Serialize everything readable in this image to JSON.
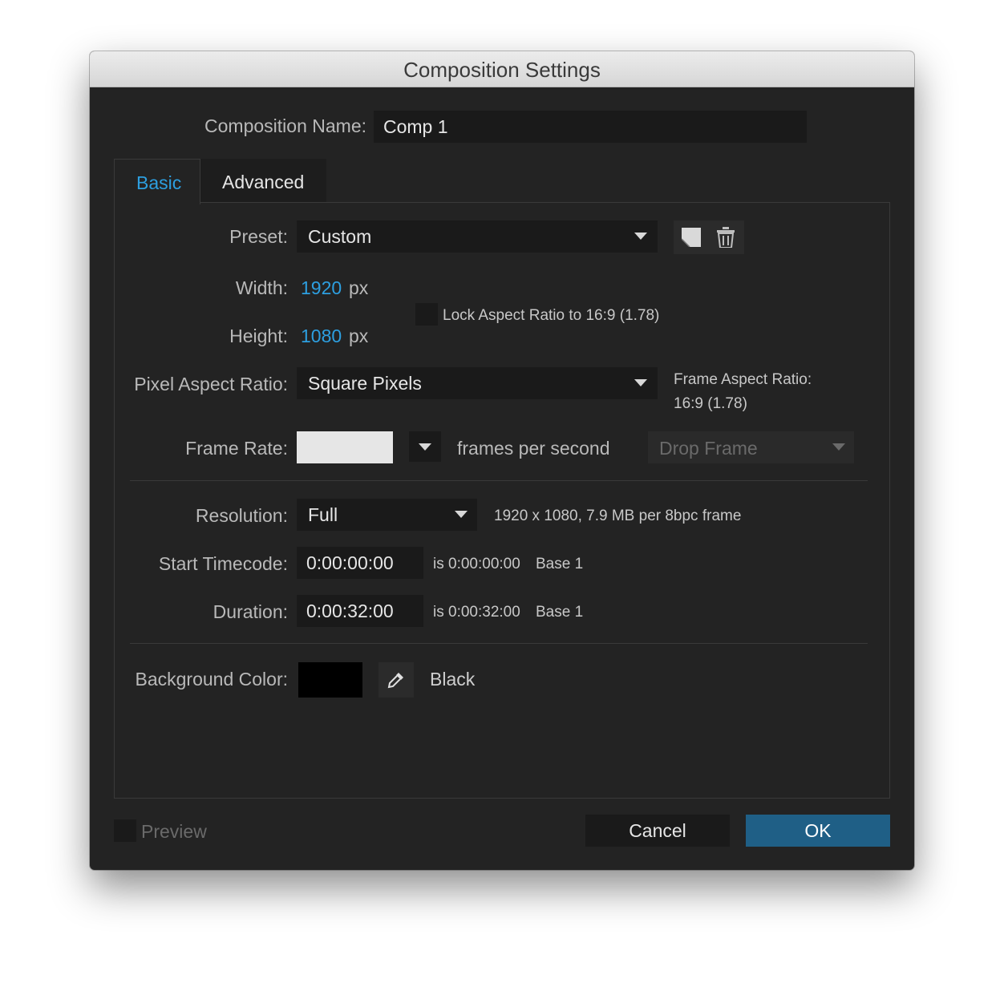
{
  "window": {
    "title": "Composition Settings"
  },
  "composition_name": {
    "label": "Composition Name:",
    "value": "Comp 1"
  },
  "tabs": [
    {
      "label": "Basic",
      "active": true
    },
    {
      "label": "Advanced",
      "active": false
    }
  ],
  "preset": {
    "label": "Preset:",
    "value": "Custom",
    "icons": [
      "save-preset-icon",
      "trash-icon"
    ]
  },
  "width": {
    "label": "Width:",
    "value": "1920",
    "unit": "px"
  },
  "height": {
    "label": "Height:",
    "value": "1080",
    "unit": "px"
  },
  "lock_aspect": {
    "label": "Lock Aspect Ratio to 16:9 (1.78)",
    "checked": false
  },
  "pixel_aspect": {
    "label": "Pixel Aspect Ratio:",
    "value": "Square Pixels"
  },
  "frame_aspect": {
    "label": "Frame Aspect Ratio:",
    "value": "16:9 (1.78)"
  },
  "frame_rate": {
    "label": "Frame Rate:",
    "value": "",
    "unit": "frames per second",
    "drop_frame": "Drop Frame"
  },
  "resolution": {
    "label": "Resolution:",
    "value": "Full",
    "info": "1920 x 1080, 7.9 MB per 8bpc frame"
  },
  "start_timecode": {
    "label": "Start Timecode:",
    "value": "0:00:00:00",
    "is": "is 0:00:00:00",
    "base": "Base 1"
  },
  "duration": {
    "label": "Duration:",
    "value": "0:00:32:00",
    "is": "is 0:00:32:00",
    "base": "Base 1"
  },
  "background": {
    "label": "Background Color:",
    "color": "#000000",
    "name": "Black",
    "icon": "eyedropper-icon"
  },
  "footer": {
    "preview_label": "Preview",
    "preview_checked": false,
    "cancel_label": "Cancel",
    "ok_label": "OK"
  },
  "colors": {
    "accent": "#2d9fe0",
    "ok_button": "#1f5f86",
    "dialog_bg": "#232323",
    "field_bg": "#1a1a1a"
  }
}
